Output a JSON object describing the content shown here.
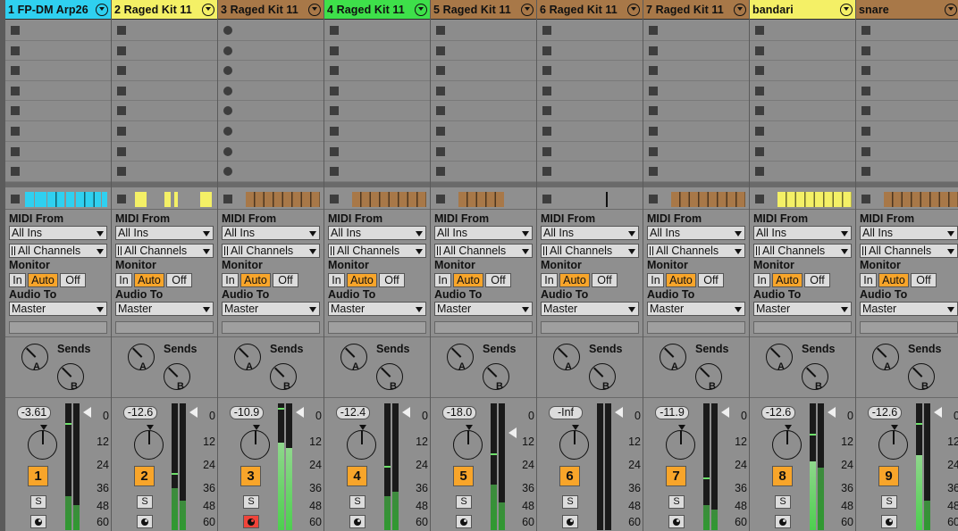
{
  "colors": {
    "auto_orange": "#f8a52a",
    "arm_red": "#f0443a",
    "cyan": "#2fd0f0",
    "yellow": "#f4f066",
    "green": "#3ee04a",
    "brown": "#a87848"
  },
  "labels": {
    "midi_from": "MIDI From",
    "monitor": "Monitor",
    "audio_to": "Audio To",
    "sends": "Sends",
    "mon_in": "In",
    "mon_auto": "Auto",
    "mon_off": "Off",
    "solo": "S",
    "send_a": "A",
    "send_b": "B"
  },
  "db_scale": [
    "0",
    "12",
    "24",
    "36",
    "48",
    "60"
  ],
  "tracks": [
    {
      "name": "1 FP-DM Arp26",
      "color": "#2fd0f0",
      "number": "1",
      "volume": "-3.61",
      "midi_from": "All Ins",
      "channel": "All Channels",
      "audio_to": "Master",
      "armed": false,
      "slot_icon": "stop",
      "clip_color": "#2fd0f0",
      "clips": [
        [
          0,
          0.11
        ],
        [
          0.12,
          0.26
        ],
        [
          0.27,
          0.48
        ],
        [
          0.5,
          0.6
        ],
        [
          0.62,
          0.92
        ],
        [
          0.94,
          1
        ]
      ],
      "meter_level": 0.27,
      "meter_peak": 0.83,
      "fader": 0.03,
      "meter2_level": 0.2
    },
    {
      "name": "2 Raged Kit 11",
      "color": "#f4f066",
      "number": "2",
      "volume": "-12.6",
      "midi_from": "All Ins",
      "channel": "All Channels",
      "audio_to": "Master",
      "armed": false,
      "slot_icon": "stop",
      "clip_color": "#f4f066",
      "clips": [
        [
          0.04,
          0.18
        ],
        [
          0.4,
          0.48
        ],
        [
          0.52,
          0.56
        ],
        [
          0.84,
          0.98
        ]
      ],
      "meter_level": 0.33,
      "meter_peak": 0.44,
      "fader": 0.03,
      "meter2_level": 0.23
    },
    {
      "name": "3 Raged Kit 11",
      "color": "#a87848",
      "number": "3",
      "volume": "-10.9",
      "midi_from": "All Ins",
      "channel": "All Channels",
      "audio_to": "Master",
      "armed": true,
      "slot_icon": "rec",
      "clip_color": "#a87848",
      "clips": [
        [
          0.1,
          1
        ]
      ],
      "meter_level": 0.69,
      "meter_peak": 0.95,
      "fader": 0.03,
      "meter2_level": 0.65
    },
    {
      "name": "4 Raged Kit 11",
      "color": "#3ee04a",
      "number": "4",
      "volume": "-12.4",
      "midi_from": "All Ins",
      "channel": "All Channels",
      "audio_to": "Master",
      "armed": false,
      "slot_icon": "stop",
      "clip_color": "#a87848",
      "clips": [
        [
          0.1,
          1
        ]
      ],
      "meter_level": 0.27,
      "meter_peak": 0.49,
      "fader": 0.03,
      "meter2_level": 0.3
    },
    {
      "name": "5 Raged Kit 11",
      "color": "#a87848",
      "number": "5",
      "volume": "-18.0",
      "midi_from": "All Ins",
      "channel": "All Channels",
      "audio_to": "Master",
      "armed": false,
      "slot_icon": "stop",
      "clip_color": "#a87848",
      "clips": [
        [
          0.1,
          0.65
        ]
      ],
      "meter_level": 0.36,
      "meter_peak": 0.59,
      "fader": 0.19,
      "meter2_level": 0.22
    },
    {
      "name": "6 Raged Kit 11",
      "color": "#a87848",
      "number": "6",
      "volume": "-Inf",
      "midi_from": "All Ins",
      "channel": "All Channels",
      "audio_to": "Master",
      "armed": false,
      "slot_icon": "stop",
      "clip_color": "#111111",
      "clips": [
        [
          0.6,
          0.62
        ]
      ],
      "meter_level": 0.0,
      "meter_peak": 0.0,
      "fader": 0.03,
      "meter2_level": 0.0
    },
    {
      "name": "7 Raged Kit 11",
      "color": "#a87848",
      "number": "7",
      "volume": "-11.9",
      "midi_from": "All Ins",
      "channel": "All Channels",
      "audio_to": "Master",
      "armed": false,
      "slot_icon": "stop",
      "clip_color": "#a87848",
      "clips": [
        [
          0.1,
          1
        ]
      ],
      "meter_level": 0.2,
      "meter_peak": 0.4,
      "fader": 0.03,
      "meter2_level": 0.16
    },
    {
      "name": "bandari",
      "color": "#f4f066",
      "number": "8",
      "volume": "-12.6",
      "midi_from": "All Ins",
      "channel": "All Channels",
      "audio_to": "Master",
      "armed": false,
      "slot_icon": "stop",
      "clip_color": "#f4f066",
      "clips": [
        [
          0.1,
          1
        ]
      ],
      "meter_level": 0.54,
      "meter_peak": 0.75,
      "fader": 0.03,
      "meter2_level": 0.49
    },
    {
      "name": "snare",
      "color": "#a87848",
      "number": "9",
      "volume": "-12.6",
      "midi_from": "All Ins",
      "channel": "All Channels",
      "audio_to": "Master",
      "armed": false,
      "slot_icon": "stop",
      "clip_color": "#a87848",
      "clips": [
        [
          0.1,
          1
        ]
      ],
      "meter_level": 0.59,
      "meter_peak": 0.83,
      "fader": 0.03,
      "meter2_level": 0.23
    }
  ]
}
